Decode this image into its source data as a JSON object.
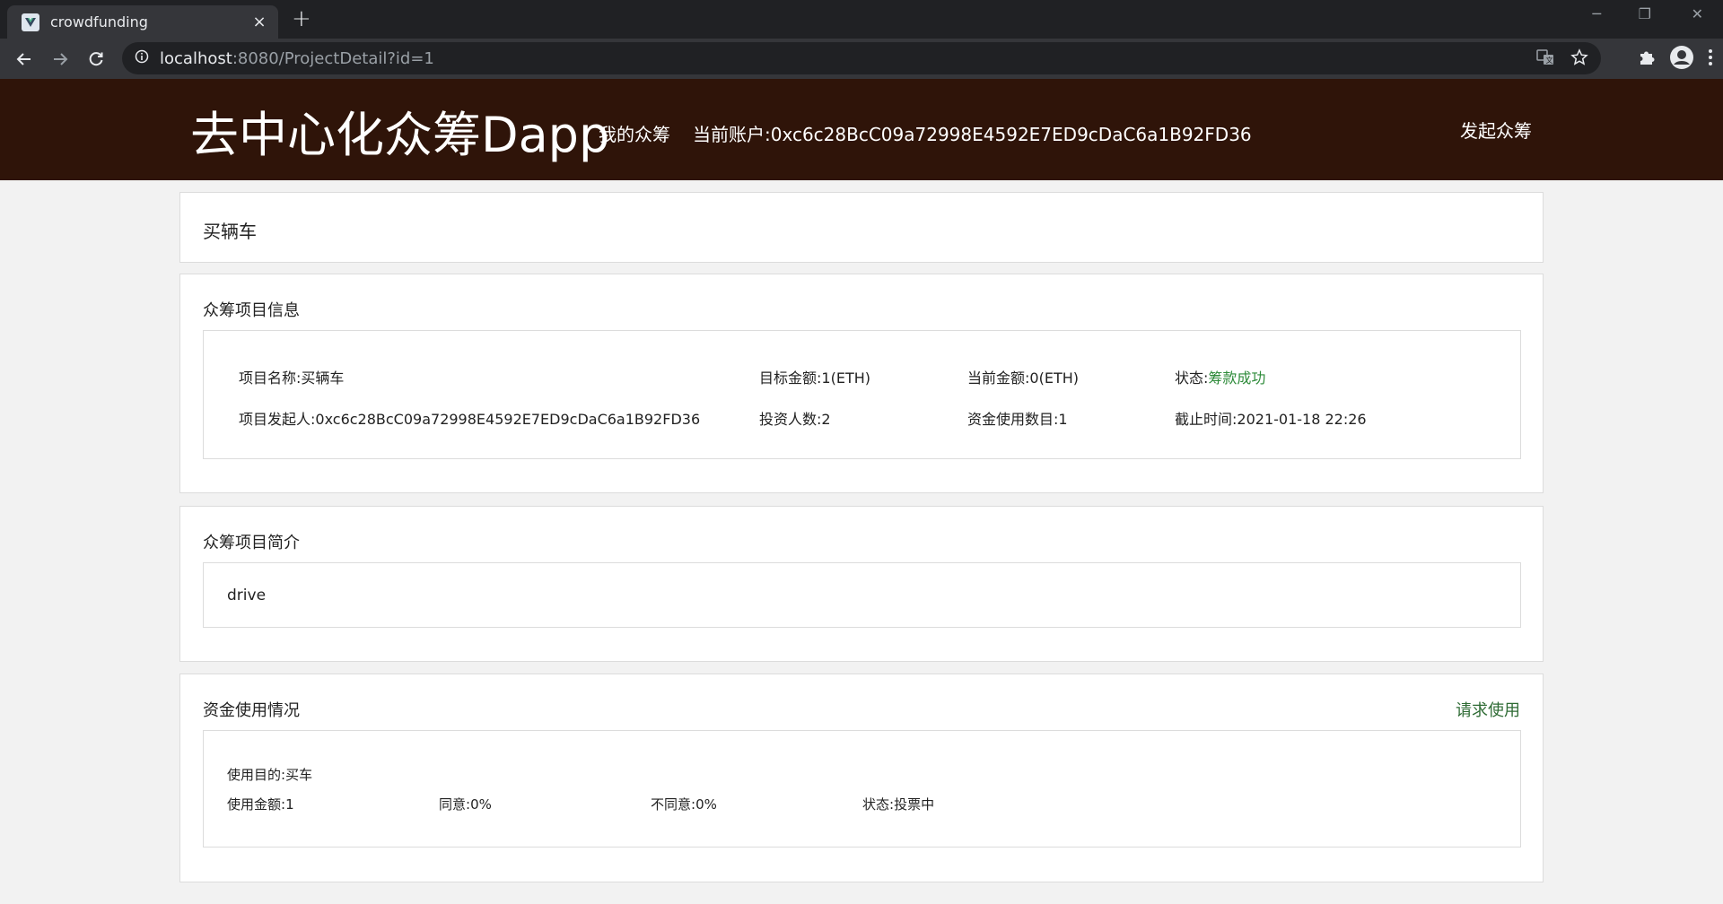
{
  "browser": {
    "tab_title": "crowdfunding",
    "tab_close": "×",
    "new_tab": "+",
    "url_host": "localhost",
    "url_rest": ":8080/ProjectDetail?id=1",
    "win_minimize": "─",
    "win_restore": "❐",
    "win_close": "✕"
  },
  "header": {
    "brand": "去中心化众筹Dapp",
    "my_crowdfunding": "我的众筹",
    "account_label": "当前账户:",
    "account": "0xc6c28BcC09a72998E4592E7ED9cDaC6a1B92FD36",
    "launch": "发起众筹"
  },
  "project": {
    "name_title": "买辆车"
  },
  "info": {
    "section_title": "众筹项目信息",
    "name_label": "项目名称:",
    "name_value": "买辆车",
    "target_label": "目标金额:",
    "target_value": "1(ETH)",
    "current_label": "当前金额:",
    "current_value": "0(ETH)",
    "status_label": "状态:",
    "status_value": "筹款成功",
    "initiator_label": "项目发起人:",
    "initiator_value": "0xc6c28BcC09a72998E4592E7ED9cDaC6a1B92FD36",
    "investors_label": "投资人数:",
    "investors_value": "2",
    "uses_label": "资金使用数目:",
    "uses_value": "1",
    "deadline_label": "截止时间:",
    "deadline_value": "2021-01-18 22:26"
  },
  "intro": {
    "section_title": "众筹项目简介",
    "text": "drive"
  },
  "usage": {
    "section_title": "资金使用情况",
    "request_link": "请求使用",
    "purpose_label": "使用目的:",
    "purpose_value": "买车",
    "amount_label": "使用金额:",
    "amount_value": "1",
    "agree_label": "同意:",
    "agree_value": "0%",
    "disagree_label": "不同意:",
    "disagree_value": "0%",
    "status_label": "状态:",
    "status_value": "投票中"
  },
  "colors": {
    "header_bg": "#2f1409",
    "status_success": "#2e8b3a"
  }
}
